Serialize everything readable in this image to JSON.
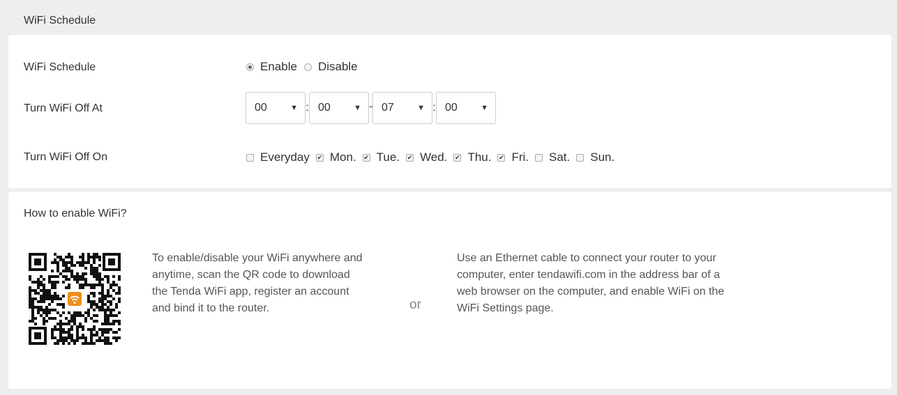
{
  "page_title": "WiFi Schedule",
  "schedule": {
    "label": "WiFi Schedule",
    "enable_label": "Enable",
    "disable_label": "Disable",
    "selected": "Enable"
  },
  "off_at": {
    "label": "Turn WiFi Off At",
    "start_hour": "00",
    "start_min": "00",
    "range_sep": "~",
    "end_hour": "07",
    "end_min": "00",
    "colon": ":"
  },
  "off_on": {
    "label": "Turn WiFi Off On",
    "days": [
      {
        "label": "Everyday",
        "checked": false
      },
      {
        "label": "Mon.",
        "checked": true
      },
      {
        "label": "Tue.",
        "checked": true
      },
      {
        "label": "Wed.",
        "checked": true
      },
      {
        "label": "Thu.",
        "checked": true
      },
      {
        "label": "Fri.",
        "checked": true
      },
      {
        "label": "Sat.",
        "checked": false
      },
      {
        "label": "Sun.",
        "checked": false
      }
    ]
  },
  "help": {
    "title": "How to enable WiFi?",
    "app_text": "To enable/disable your WiFi anywhere and anytime, scan the QR code to download the Tenda WiFi app, register an account and bind it to the router.",
    "or": "or",
    "web_text": "Use an Ethernet cable to connect your router to your computer, enter tendawifi.com in the address bar of a web browser on the computer, and enable WiFi on the WiFi Settings page."
  },
  "colors": {
    "qr_badge": "#f08d1c"
  },
  "icons": {
    "qr": "qr-code-image",
    "wifi_badge": "wifi-icon"
  }
}
